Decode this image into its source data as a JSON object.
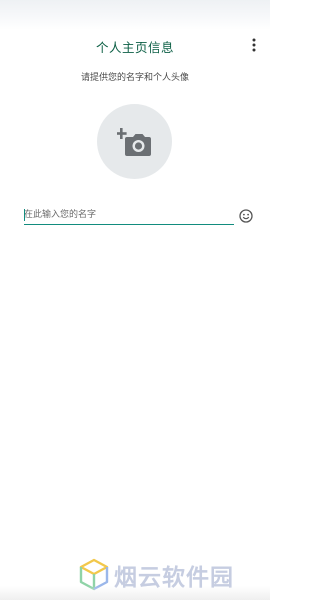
{
  "header": {
    "title": "个人主页信息",
    "menu_icon": "more-vertical-icon"
  },
  "profile": {
    "instruction": "请提供您的名字和个人头像",
    "avatar_icon": "add-photo-camera-icon",
    "name_placeholder": "在此输入您的名字",
    "emoji_icon": "emoji-smile-icon"
  },
  "watermark": {
    "text": "烟云软件园",
    "logo_icon": "cube-logo-icon"
  },
  "colors": {
    "accent": "#128c7e",
    "title": "#0c5f45",
    "avatar_bg": "#e6e9eb",
    "icon_gray": "#5f6368"
  }
}
